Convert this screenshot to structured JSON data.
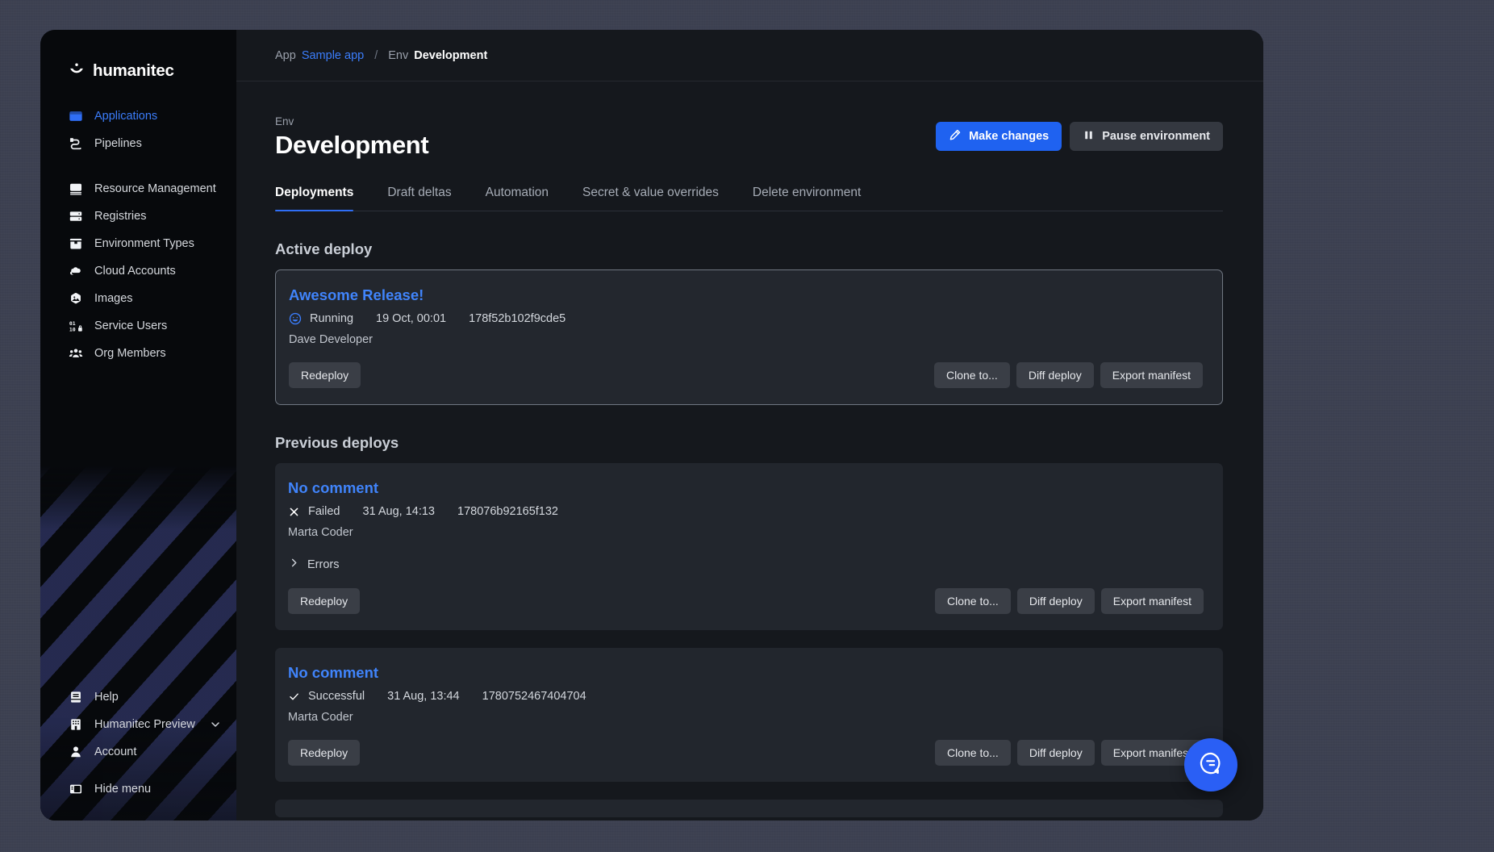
{
  "brand": {
    "name": "humanitec",
    "mark": "smiley-mark-icon"
  },
  "sidebar": {
    "primary": [
      {
        "label": "Applications",
        "icon": "applications-icon",
        "active": true
      },
      {
        "label": "Pipelines",
        "icon": "pipelines-icon",
        "active": false
      }
    ],
    "secondary": [
      {
        "label": "Resource Management",
        "icon": "resource-management-icon"
      },
      {
        "label": "Registries",
        "icon": "registries-icon"
      },
      {
        "label": "Environment Types",
        "icon": "environment-types-icon"
      },
      {
        "label": "Cloud Accounts",
        "icon": "cloud-accounts-icon"
      },
      {
        "label": "Images",
        "icon": "images-icon"
      },
      {
        "label": "Service Users",
        "icon": "service-users-icon"
      },
      {
        "label": "Org Members",
        "icon": "org-members-icon"
      }
    ],
    "bottom": [
      {
        "label": "Help",
        "icon": "help-book-icon",
        "chevron": false
      },
      {
        "label": "Humanitec Preview",
        "icon": "organization-icon",
        "chevron": true
      },
      {
        "label": "Account",
        "icon": "account-person-icon",
        "chevron": false
      }
    ],
    "hide_menu": {
      "label": "Hide menu",
      "icon": "hide-menu-icon"
    }
  },
  "breadcrumb": {
    "app_label": "App",
    "app_name": "Sample app",
    "separator": "/",
    "env_label": "Env",
    "env_name": "Development"
  },
  "header": {
    "eyebrow": "Env",
    "title": "Development",
    "make_changes_label": "Make changes",
    "pause_label": "Pause environment"
  },
  "tabs": [
    {
      "label": "Deployments",
      "active": true
    },
    {
      "label": "Draft deltas",
      "active": false
    },
    {
      "label": "Automation",
      "active": false
    },
    {
      "label": "Secret & value overrides",
      "active": false
    },
    {
      "label": "Delete environment",
      "active": false
    }
  ],
  "sections": {
    "active_title": "Active deploy",
    "previous_title": "Previous deploys"
  },
  "buttons": {
    "redeploy": "Redeploy",
    "clone_to": "Clone to...",
    "diff_deploy": "Diff deploy",
    "export_manifest": "Export manifest",
    "errors": "Errors"
  },
  "active_deploy": {
    "name": "Awesome Release!",
    "status": "Running",
    "status_icon": "running-smiley-icon",
    "date": "19 Oct, 00:01",
    "id": "178f52b102f9cde5",
    "author": "Dave Developer"
  },
  "previous_deploys": [
    {
      "name": "No comment",
      "status": "Failed",
      "status_icon": "failed-x-icon",
      "date": "31 Aug, 14:13",
      "id": "178076b92165f132",
      "author": "Marta Coder",
      "has_errors": true
    },
    {
      "name": "No comment",
      "status": "Successful",
      "status_icon": "success-check-icon",
      "date": "31 Aug, 13:44",
      "id": "1780752467404704",
      "author": "Marta Coder",
      "has_errors": false
    }
  ],
  "chat": {
    "icon": "chat-bubble-icon",
    "label": "Open chat"
  },
  "colors": {
    "accent": "#2f6ef5",
    "link": "#4084fb",
    "window_bg": "#15181d",
    "sidebar_bg": "#07090c",
    "card_bg": "#22262d"
  }
}
